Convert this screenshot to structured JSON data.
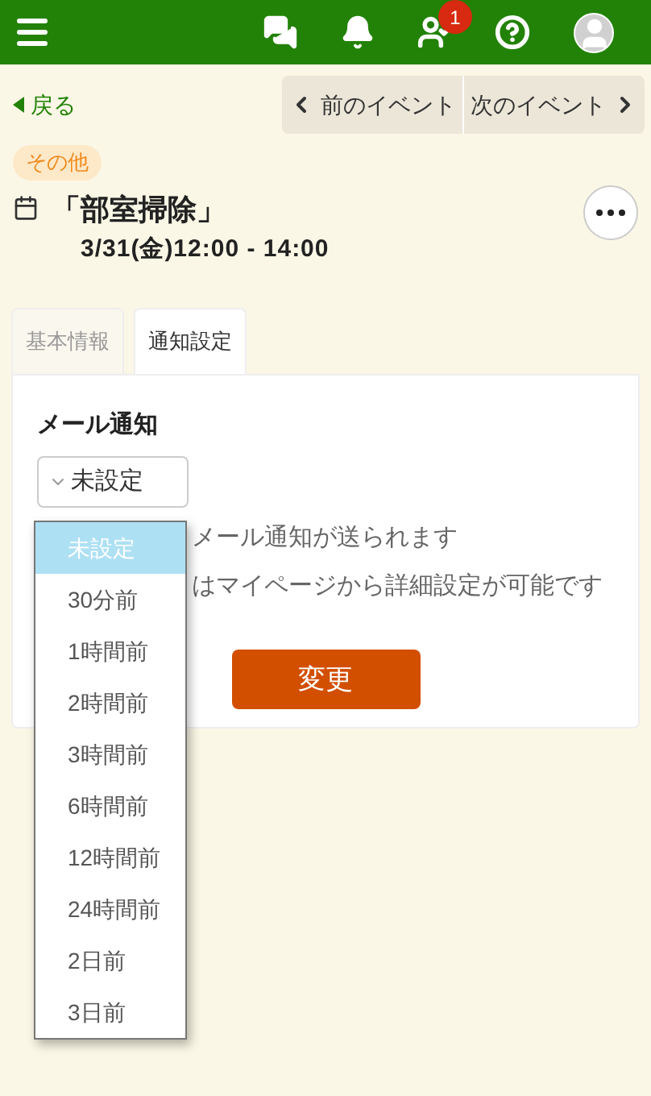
{
  "header": {
    "badge": "1"
  },
  "nav": {
    "back": "戻る",
    "prev": "前のイベント",
    "next": "次のイベント"
  },
  "event": {
    "tag": "その他",
    "title": "「部室掃除」",
    "datetime": "3/31(金)12:00 - 14:00"
  },
  "tabs": [
    {
      "label": "基本情報",
      "selected": false
    },
    {
      "label": "通知設定",
      "selected": true
    }
  ],
  "mail": {
    "label": "メール通知",
    "value": "未設定",
    "lines": [
      "メール通知が送られます",
      "はマイページから詳細設定が可能です"
    ],
    "button": "変更"
  },
  "dropdown": [
    {
      "label": "未設定",
      "selected": true
    },
    {
      "label": "30分前",
      "selected": false
    },
    {
      "label": "1時間前",
      "selected": false
    },
    {
      "label": "2時間前",
      "selected": false
    },
    {
      "label": "3時間前",
      "selected": false
    },
    {
      "label": "6時間前",
      "selected": false
    },
    {
      "label": "12時間前",
      "selected": false
    },
    {
      "label": "24時間前",
      "selected": false
    },
    {
      "label": "2日前",
      "selected": false
    },
    {
      "label": "3日前",
      "selected": false
    }
  ]
}
